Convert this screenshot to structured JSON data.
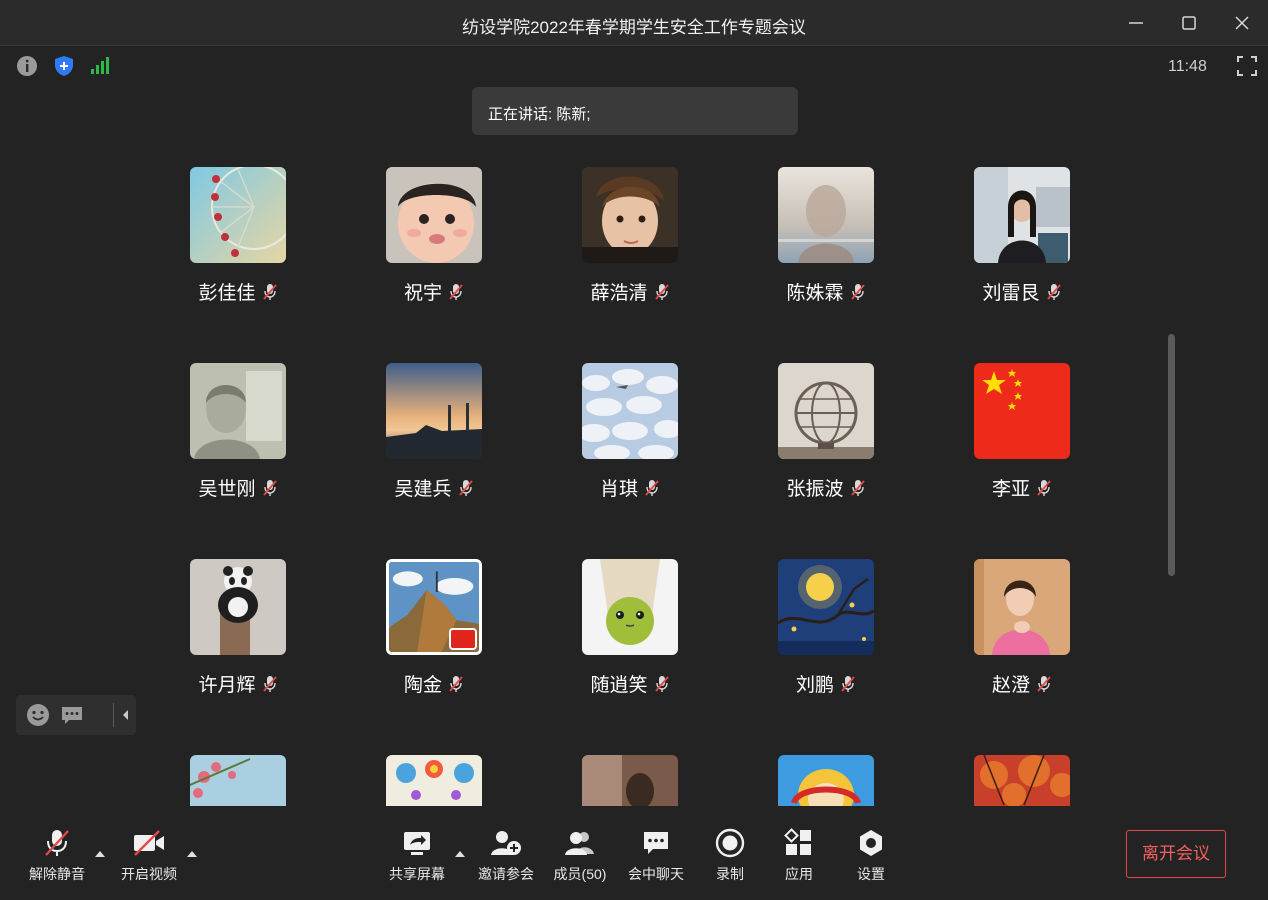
{
  "window": {
    "title": "纺设学院2022年春学期学生安全工作专题会议"
  },
  "status": {
    "clock": "11:48"
  },
  "speaking": {
    "text": "正在讲话: 陈新;"
  },
  "participants": [
    {
      "name": "彭佳佳"
    },
    {
      "name": "祝宇"
    },
    {
      "name": "薛浩清"
    },
    {
      "name": "陈姝霖"
    },
    {
      "name": "刘雷艮"
    },
    {
      "name": "吴世刚"
    },
    {
      "name": "吴建兵"
    },
    {
      "name": "肖琪"
    },
    {
      "name": "张振波"
    },
    {
      "name": "李亚"
    },
    {
      "name": "许月辉"
    },
    {
      "name": "陶金"
    },
    {
      "name": "随逍笑"
    },
    {
      "name": "刘鹏"
    },
    {
      "name": "赵澄"
    }
  ],
  "toolbar": {
    "unmute": "解除静音",
    "start_video": "开启视频",
    "share_screen": "共享屏幕",
    "invite": "邀请参会",
    "members": "成员(50)",
    "chat": "会中聊天",
    "record": "录制",
    "apps": "应用",
    "settings": "设置",
    "leave": "离开会议"
  },
  "colors": {
    "background": "#232323",
    "leave": "#e04a4a",
    "shield": "#2f7bf5",
    "signal": "#2fb84a"
  }
}
